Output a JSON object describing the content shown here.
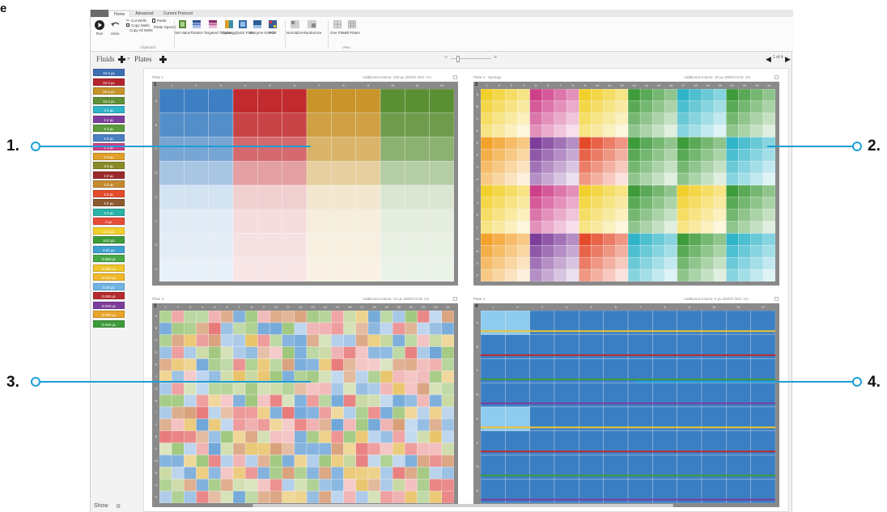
{
  "corner_letter": "e",
  "ribbon": {
    "tabs": [
      "Home",
      "Advanced",
      "Current Protocol"
    ],
    "active_tab": 0,
    "buttons": {
      "run": "Run",
      "undo": "Undo",
      "cut_wells": "Cut Wells",
      "copy_wells": "Copy Wells",
      "copy_all_wells": "Copy All Wells",
      "paste": "Paste",
      "paste_special": "Paste Special",
      "set_value": "Set Value",
      "titration": "Titration",
      "targeted_titration": "Targeted Titration",
      "synergy": "Synergy",
      "quick_plate": "Quick Plate",
      "enzyme_kinetic": "Enzyme Kinetic",
      "pcr": "PCR",
      "normalize": "Normalize",
      "randomize": "Randomize",
      "one_plate": "One Plate",
      "all_plates": "All Plates"
    },
    "group_labels": {
      "clipboard": "Clipboard",
      "view": "View"
    }
  },
  "toolbar": {
    "fluids_label": "Fluids",
    "plates_label": "Plates",
    "pager_text": "1 of 4"
  },
  "fluids": [
    {
      "label": "10.4 µL",
      "color": "#3d6fb4"
    },
    {
      "label": "10.4 µL",
      "color": "#b3252c"
    },
    {
      "label": "10.4 µL",
      "color": "#c7942a"
    },
    {
      "label": "10.4 µL",
      "color": "#5f8f36"
    },
    {
      "label": "2.4 µL",
      "color": "#2fb4c8"
    },
    {
      "label": "2.4 µL",
      "color": "#7d3d9a"
    },
    {
      "label": "2.3 µL",
      "color": "#5b9b3d"
    },
    {
      "label": "2.0 µL",
      "color": "#4a7fc0"
    },
    {
      "label": "2.3 µL",
      "color": "#cf3f89"
    },
    {
      "label": "2.0 µL",
      "color": "#e0a02a"
    },
    {
      "label": "2.0 µL",
      "color": "#8a8a28"
    },
    {
      "label": "2.0 µL",
      "color": "#9b2b2b"
    },
    {
      "label": "2.0 µL",
      "color": "#c48a2e"
    },
    {
      "label": "2.0 µL",
      "color": "#e34b2a"
    },
    {
      "label": "2.0 µL",
      "color": "#8b5a2e"
    },
    {
      "label": "2.0 µL",
      "color": "#2bb3a8"
    },
    {
      "label": "0 µL",
      "color": "#e64c39"
    },
    {
      "label": "10.0 µL",
      "color": "#f2d02b"
    },
    {
      "label": "10.0 µL",
      "color": "#3e9b3a"
    },
    {
      "label": "0.01 µL",
      "color": "#3da0d0"
    },
    {
      "label": "0.050 µL",
      "color": "#46a846"
    },
    {
      "label": "0.005 µL",
      "color": "#f0c52b"
    },
    {
      "label": "0.012 µL",
      "color": "#f0b82b"
    },
    {
      "label": "0.20 µL",
      "color": "#6fb4e3"
    },
    {
      "label": "0.040 µL",
      "color": "#b52a2e"
    },
    {
      "label": "0.040 µL",
      "color": "#7d3d9a"
    },
    {
      "label": "0.040 µL",
      "color": "#e8a52b"
    },
    {
      "label": "0.040 µL",
      "color": "#3e9b3a"
    }
  ],
  "plates": [
    {
      "number": "1",
      "title": "Plate 1",
      "info": "Additional volume: 100 µL   DMSO limit: 1%"
    },
    {
      "number": "2",
      "title": "Plate 2 - Synergy",
      "info": "Additional volume: 10 µL   DMSO limit: 1%"
    },
    {
      "number": "3",
      "title": "Plate 3",
      "info": "Additional volume: 10 µL   DMSO limit: 1%"
    },
    {
      "number": "4",
      "title": "Plate 4",
      "info": "Additional volume: 0 µL   DMSO limit: 1%"
    }
  ],
  "bottom": {
    "show_label": "Show"
  },
  "callouts": [
    "1.",
    "2.",
    "3.",
    "4."
  ]
}
